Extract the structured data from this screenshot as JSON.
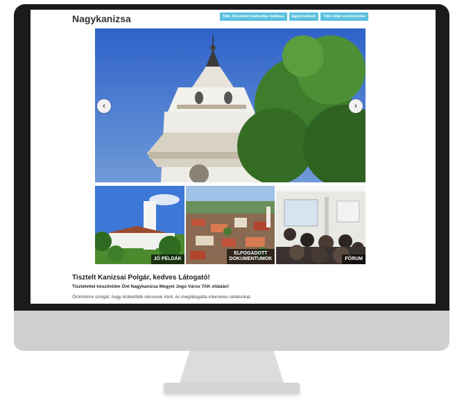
{
  "site": {
    "title": "Nagykanizsa"
  },
  "nav": {
    "items": [
      "TAK, Rendelet módosítás indítása",
      "Egyeztetések",
      "TAK oldal szerkesztése"
    ]
  },
  "slider": {
    "prev_label": "‹",
    "next_label": "›"
  },
  "tiles": [
    {
      "label_line1": "JÓ PÉLDÁK",
      "label_line2": ""
    },
    {
      "label_line1": "ELFOGADOTT",
      "label_line2": "DOKUMENTUMOK"
    },
    {
      "label_line1": "FÓRUM",
      "label_line2": ""
    }
  ],
  "welcome": {
    "title": "Tisztelt Kanizsai Polgár, kedves Látogató!",
    "subtitle": "Tisztelettel köszöntöm Önt Nagykanizsa Megyei Jogú Város TAK oldalán!",
    "body": "Örömömre szolgál, hogy érdeklődik városunk iránt, és meglátogatta internetes oldalunkat."
  },
  "colors": {
    "nav_accent": "#5bc0de",
    "bezel": "#1b1b1b",
    "chin": "#cfcfcf"
  }
}
